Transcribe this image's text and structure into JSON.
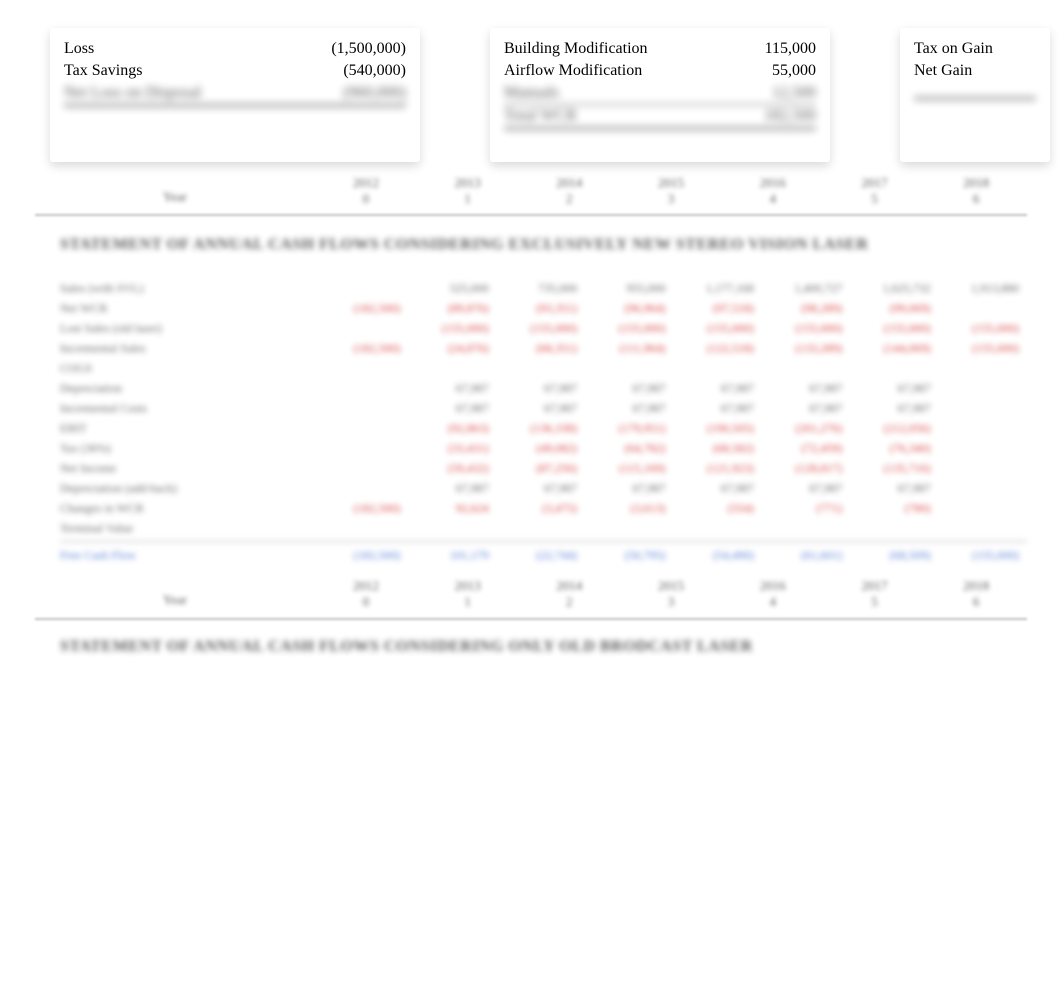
{
  "boxes": {
    "left": {
      "r1": {
        "label": "Loss",
        "val": "(1,500,000)"
      },
      "r2": {
        "label": "Tax Savings",
        "val": "(540,000)"
      },
      "r3": {
        "label": "Net Loss on Disposal",
        "val": "(960,000)"
      }
    },
    "mid": {
      "r1": {
        "label": "Building Modification",
        "val": "115,000"
      },
      "r2": {
        "label": "Airflow Modification",
        "val": "55,000"
      },
      "r3": {
        "label": "Manuals",
        "val": "12,500"
      },
      "r4": {
        "label": "Total WCR",
        "val": "182,500"
      }
    },
    "right": {
      "r1": {
        "label": "Tax on Gain",
        "val": ""
      },
      "r2": {
        "label": "Net Gain",
        "val": ""
      }
    }
  },
  "years": {
    "left_label": "Year",
    "cols": [
      "2012",
      "2013",
      "2014",
      "2015",
      "2016",
      "2017",
      "2018"
    ],
    "sub": [
      "0",
      "1",
      "2",
      "3",
      "4",
      "5",
      "6"
    ]
  },
  "section1_title": "STATEMENT OF ANNUAL CASH FLOWS CONSIDERING EXCLUSIVELY NEW STEREO VISION LASER",
  "section2_title": "STATEMENT OF ANNUAL CASH FLOWS CONSIDERING ONLY OLD BRODCAST LASER",
  "sheet": {
    "rows": [
      {
        "label": "Sales (with SVL)",
        "vals": [
          "",
          "525,000",
          "735,000",
          "955,000",
          "1,177,168",
          "1,400,727",
          "1,625,732",
          "1,913,880"
        ]
      },
      {
        "label": "Net WCR",
        "vals": [
          "(182,500)",
          "(89,876)",
          "(93,351)",
          "(96,964)",
          "(97,518)",
          "(98,289)",
          "(99,069)",
          ""
        ]
      },
      {
        "label": "Lost Sales (old laser)",
        "vals": [
          "",
          "(155,000)",
          "(155,000)",
          "(155,000)",
          "(155,000)",
          "(155,000)",
          "(155,000)",
          "(155,000)"
        ],
        "neg": true
      },
      {
        "label": "Incremental Sales",
        "vals": [
          "(182,500)",
          "(24,876)",
          "(68,351)",
          "(111,964)",
          "(122,518)",
          "(133,289)",
          "(144,069)",
          "(155,000)"
        ],
        "neg": true
      },
      {
        "label": "COGS",
        "vals": [
          "",
          "",
          "",
          "",
          "",
          "",
          "",
          ""
        ]
      },
      {
        "label": "Depreciation",
        "vals": [
          "",
          "67,987",
          "67,987",
          "67,987",
          "67,987",
          "67,987",
          "67,987",
          ""
        ]
      },
      {
        "label": "Incremental Costs",
        "vals": [
          "",
          "67,987",
          "67,987",
          "67,987",
          "67,987",
          "67,987",
          "67,987",
          ""
        ]
      },
      {
        "label": "EBIT",
        "vals": [
          "",
          "(92,863)",
          "(136,338)",
          "(179,951)",
          "(190,505)",
          "(201,276)",
          "(212,056)",
          ""
        ]
      },
      {
        "label": "Tax (36%)",
        "vals": [
          "",
          "(33,431)",
          "(49,082)",
          "(64,782)",
          "(68,582)",
          "(72,459)",
          "(76,340)",
          ""
        ]
      },
      {
        "label": "Net Income",
        "vals": [
          "",
          "(59,432)",
          "(87,256)",
          "(115,169)",
          "(121,923)",
          "(128,817)",
          "(135,716)",
          ""
        ]
      },
      {
        "label": "Depreciation (add-back)",
        "vals": [
          "",
          "67,987",
          "67,987",
          "67,987",
          "67,987",
          "67,987",
          "67,987",
          ""
        ]
      },
      {
        "label": "Changes in WCR",
        "vals": [
          "(182,500)",
          "92,624",
          "(3,475)",
          "(3,613)",
          "(554)",
          "(771)",
          "(780)",
          ""
        ],
        "neg": true
      },
      {
        "label": "Terminal Value",
        "vals": [
          "",
          "",
          "",
          "",
          "",
          "",
          "",
          ""
        ]
      }
    ],
    "total": {
      "label": "Free Cash Flow",
      "vals": [
        "(182,500)",
        "101,179",
        "(22,744)",
        "(50,795)",
        "(54,490)",
        "(61,601)",
        "(68,509)",
        "(155,000)"
      ]
    }
  }
}
